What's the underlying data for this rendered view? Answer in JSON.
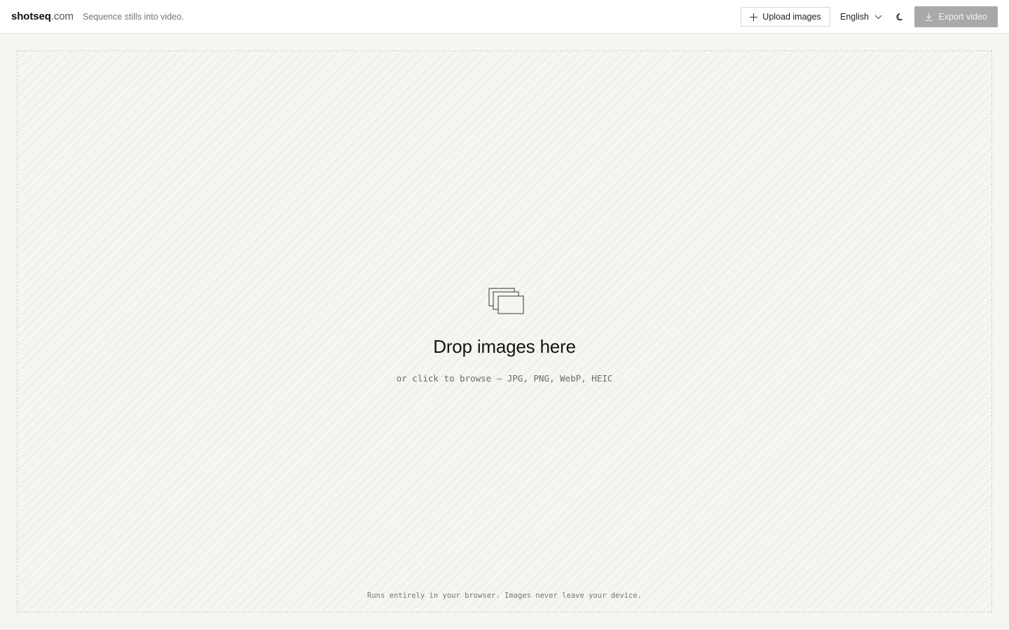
{
  "header": {
    "brand_name": "shotseq",
    "brand_tld": ".com",
    "tagline": "Sequence stills into video.",
    "upload_label": "Upload images",
    "language": "English",
    "export_label": "Export video",
    "icons": {
      "upload": "plus-icon",
      "language": "chevron-down-icon",
      "theme": "moon-icon",
      "export": "download-icon"
    }
  },
  "dropzone": {
    "icon": "image-stack-icon",
    "title": "Drop images here",
    "subtitle": "or click to browse — JPG, PNG, WebP, HEIC",
    "privacy_note": "Runs entirely in your browser. Images never leave your device."
  },
  "colors": {
    "background": "#f6f5f1",
    "header_bg": "#ffffff",
    "export_disabled_bg": "#a9a9a9"
  }
}
